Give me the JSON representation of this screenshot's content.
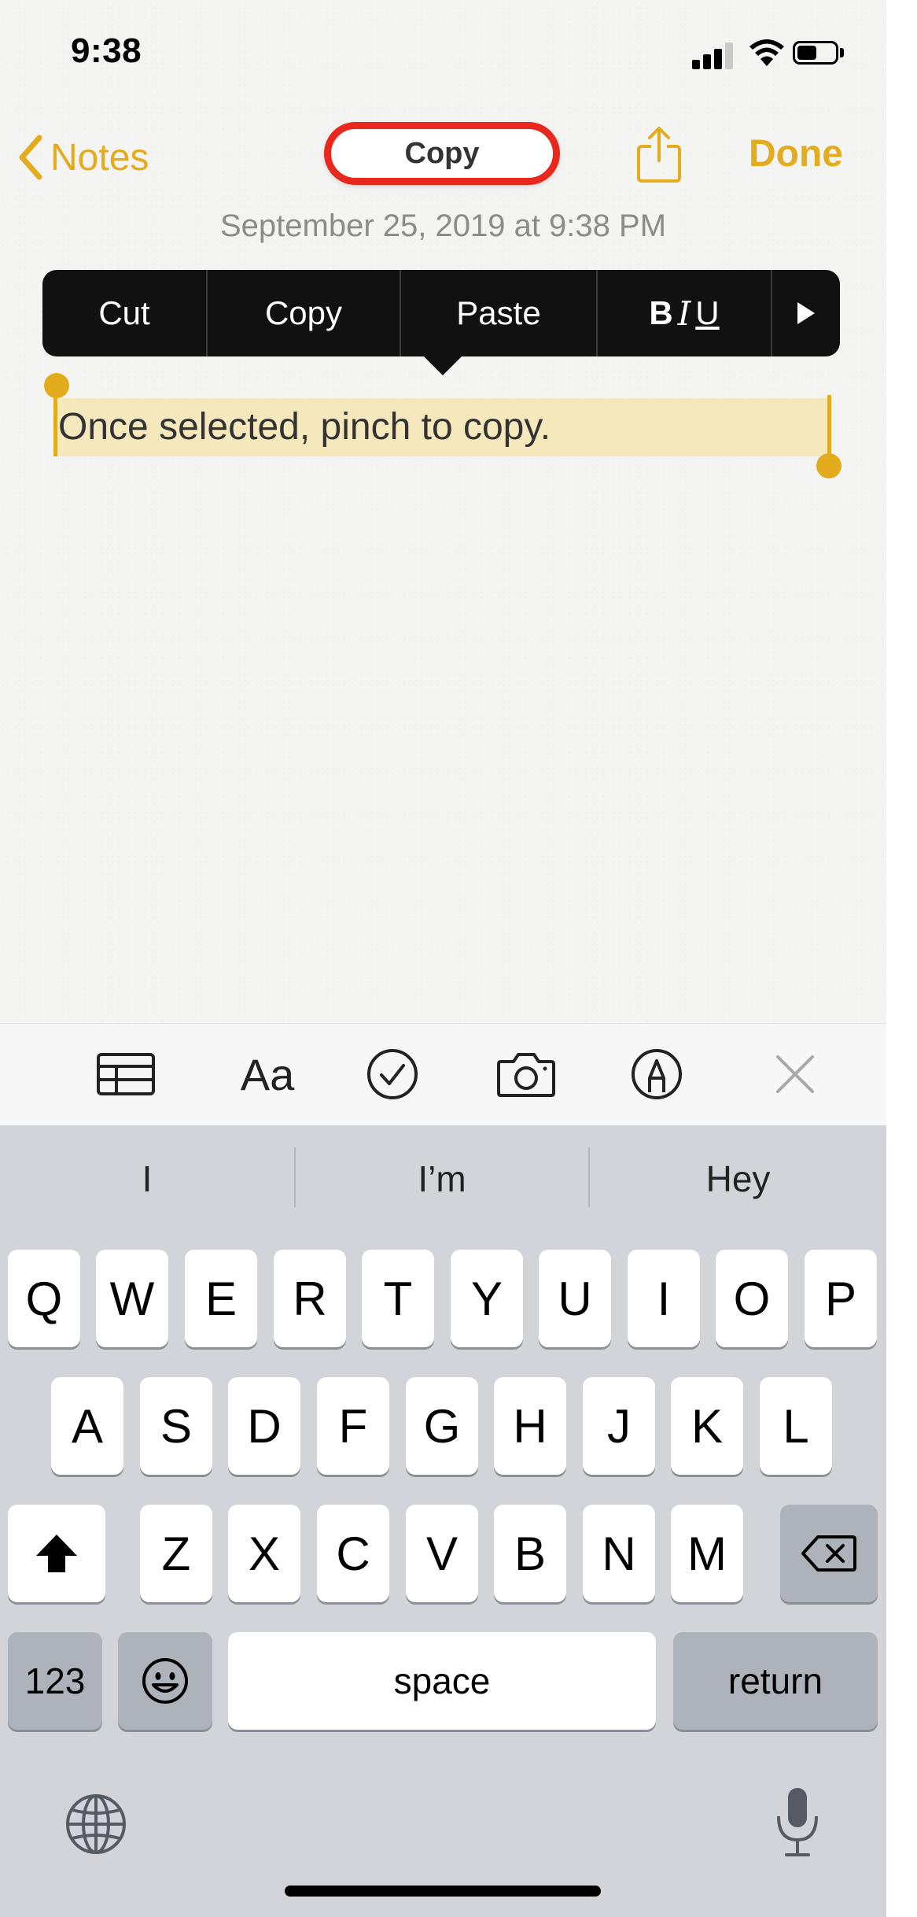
{
  "status_bar": {
    "time": "9:38"
  },
  "nav": {
    "back_label": "Notes",
    "center_pill_label": "Copy",
    "done_label": "Done"
  },
  "note": {
    "date": "September 25, 2019 at 9:38 PM",
    "text": "Once selected, pinch to copy."
  },
  "edit_menu": {
    "cut": "Cut",
    "copy": "Copy",
    "paste": "Paste",
    "bold": "B",
    "italic": "I",
    "underline": "U"
  },
  "toolbar": {
    "format_label": "Aa"
  },
  "keyboard": {
    "suggestions": [
      "I",
      "I’m",
      "Hey"
    ],
    "row1": [
      "Q",
      "W",
      "E",
      "R",
      "T",
      "Y",
      "U",
      "I",
      "O",
      "P"
    ],
    "row2": [
      "A",
      "S",
      "D",
      "F",
      "G",
      "H",
      "J",
      "K",
      "L"
    ],
    "row3": [
      "Z",
      "X",
      "C",
      "V",
      "B",
      "N",
      "M"
    ],
    "numbers_label": "123",
    "space_label": "space",
    "return_label": "return"
  },
  "colors": {
    "accent": "#e3ac1c",
    "highlight_ring": "#e8281c",
    "selection": "#f6e8bd",
    "menu_bg": "#111111",
    "keyboard_bg": "#d2d4da"
  },
  "icons": [
    "back-chevron-icon",
    "share-icon",
    "table-icon",
    "checklist-icon",
    "camera-icon",
    "markup-icon",
    "close-icon",
    "shift-icon",
    "delete-icon",
    "emoji-icon",
    "globe-icon",
    "microphone-icon",
    "play-icon"
  ]
}
